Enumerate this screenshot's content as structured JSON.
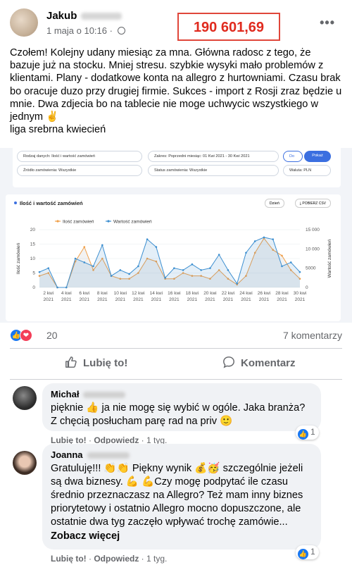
{
  "post": {
    "author": "Jakub",
    "date": "1 maja o 10:16",
    "audience_icon": "globe-icon",
    "highlight_amount": "190 601,69",
    "text": "Czołem! Kolejny udany miesiąc za mna. Główna radosc z tego, że bazuje już na stocku. Mniej stresu. szybkie wysyki mało problemów z klientami. Plany - dodatkowe konta na allegro z hurtowniami. Czasu brak bo oracuje duzo przy drugiej firmie. Sukces - import z Rosji zraz będzie u mnie. Dwa zdjecia bo na tablecie nie moge uchwycic wszystkiego w jednym ✌",
    "text_last_line": "liga srebrna kwiecień"
  },
  "embed": {
    "filters": {
      "data_type": "Rodzaj danych: Ilość i wartość zamówień",
      "range": "Zakres: Poprzedni miesiąc: 01 Kwi 2021 - 30 Kwi 2021",
      "compare_label": "Do",
      "show_button": "Pokaż",
      "source": "Źródło zamówienia: Wszystkie",
      "status": "Status zamówienia: Wszystkie",
      "currency": "Waluta: PLN"
    },
    "chart_title": "Ilość i wartość zamówień",
    "period_select": "Dzień",
    "csv_button": "⤓ POBIERZ CSV"
  },
  "chart_data": {
    "type": "line",
    "title": "Ilość i wartość zamówień",
    "xlabel": "",
    "ylabel": "Ilość zamówień",
    "y2label": "Wartość zamówień",
    "ylim": [
      0,
      20
    ],
    "y2lim": [
      0,
      15000
    ],
    "yticks": [
      0,
      5,
      10,
      15,
      20
    ],
    "y2ticks": [
      "0",
      "5000",
      "10 000",
      "15 000"
    ],
    "grid": true,
    "legend": "top-left",
    "x_tick_labels": [
      [
        "2 kwi",
        "2021"
      ],
      [
        "4 kwi",
        "2021"
      ],
      [
        "6 kwi",
        "2021"
      ],
      [
        "8 kwi",
        "2021"
      ],
      [
        "10 kwi",
        "2021"
      ],
      [
        "12 kwi",
        "2021"
      ],
      [
        "14 kwi",
        "2021"
      ],
      [
        "16 kwi",
        "2021"
      ],
      [
        "18 kwi",
        "2021"
      ],
      [
        "20 kwi",
        "2021"
      ],
      [
        "22 kwi",
        "2021"
      ],
      [
        "24 kwi",
        "2021"
      ],
      [
        "26 kwi",
        "2021"
      ],
      [
        "28 kwi",
        "2021"
      ],
      [
        "30 kwi",
        "2021"
      ]
    ],
    "x": [
      "1 kwi",
      "2 kwi",
      "3 kwi",
      "4 kwi",
      "5 kwi",
      "6 kwi",
      "7 kwi",
      "8 kwi",
      "9 kwi",
      "10 kwi",
      "11 kwi",
      "12 kwi",
      "13 kwi",
      "14 kwi",
      "15 kwi",
      "16 kwi",
      "17 kwi",
      "18 kwi",
      "19 kwi",
      "20 kwi",
      "21 kwi",
      "22 kwi",
      "23 kwi",
      "24 kwi",
      "25 kwi",
      "26 kwi",
      "27 kwi",
      "28 kwi",
      "29 kwi",
      "30 kwi"
    ],
    "series": [
      {
        "name": "Ilość zamówień",
        "color": "#f0a04b",
        "axis": "left",
        "values": [
          4,
          5,
          0,
          0,
          9,
          14,
          6,
          10,
          4,
          3,
          3,
          5,
          10,
          9,
          3,
          3,
          5,
          4,
          4,
          3,
          6,
          3,
          1,
          4,
          12,
          17,
          13,
          11,
          6,
          3
        ]
      },
      {
        "name": "Wartość zamówień",
        "color": "#3d8fd0",
        "axis": "right",
        "values": [
          4000,
          5000,
          0,
          0,
          7500,
          6500,
          5500,
          11000,
          3000,
          4500,
          3500,
          5500,
          12500,
          10500,
          2500,
          5000,
          4500,
          6000,
          4500,
          5000,
          8500,
          4500,
          1000,
          9000,
          12000,
          13000,
          12500,
          5500,
          6500,
          4000
        ]
      }
    ]
  },
  "reactions": {
    "like_icon": "like-icon",
    "love_icon": "love-icon",
    "count": "20",
    "comments_count": "7 komentarzy"
  },
  "actions": {
    "like": "Lubię to!",
    "comment": "Komentarz"
  },
  "comments": [
    {
      "author": "Michał",
      "text": "pięknie 👍 ja nie mogę się wybić w ogóle. Jaka branża? Z chęcią posłucham parę rad na priv 🙂",
      "like_label": "Lubię to!",
      "reply_label": "Odpowiedz",
      "time": "1 tyg.",
      "reaction_count": "1"
    },
    {
      "author": "Joanna",
      "text": "Gratuluję!!! 👏👏 Piękny wynik 💰🥳 szczególnie jeżeli są dwa biznesy. 💪 💪Czy mogę podpytać ile czasu średnio przeznaczasz na Allegro? Też mam inny biznes priorytetowy i ostatnio Allegro mocno dopuszczone, ale ostatnie dwa tyg zaczęło wpływać trochę zamówie...",
      "see_more": "Zobacz więcej",
      "like_label": "Lubię to!",
      "reply_label": "Odpowiedz",
      "time": "1 tyg.",
      "reaction_count": "1"
    }
  ]
}
